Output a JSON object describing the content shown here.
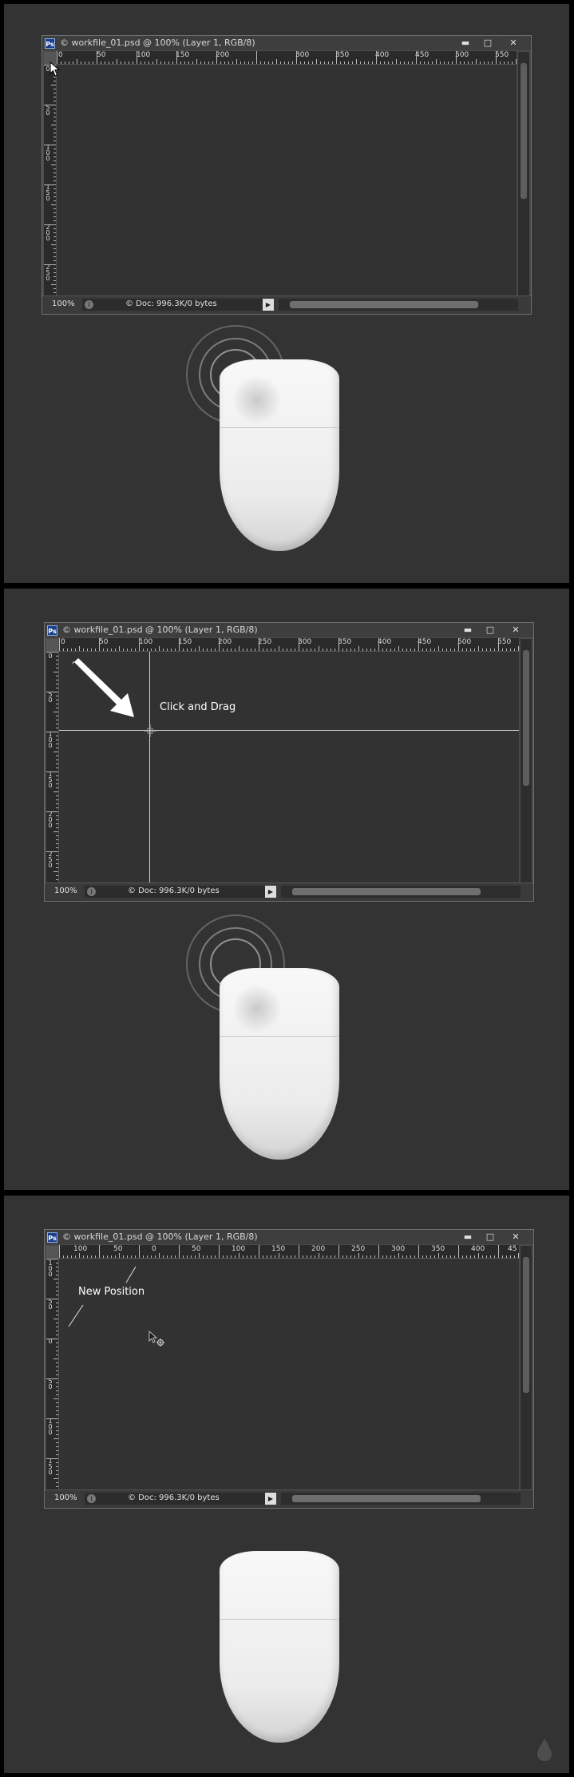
{
  "window": {
    "ps_badge": "Ps",
    "title": "© workfile_01.psd @ 100% (Layer 1, RGB/8)",
    "minimize_glyph": "▬",
    "maximize_glyph": "□",
    "close_glyph": "✕"
  },
  "status_bar": {
    "zoom": "100%",
    "doc_info": "© Doc: 996.3K/0 bytes",
    "doc_menu_glyph": "▶"
  },
  "steps": [
    {
      "h_ruler_labels": [
        "0",
        "50",
        "100",
        "150",
        "200",
        "300",
        "350",
        "400",
        "450",
        "500",
        "550"
      ],
      "v_ruler_labels": [
        "0",
        "50",
        "100",
        "150",
        "200",
        "250"
      ],
      "mouse_left_click_active": true
    },
    {
      "h_ruler_labels": [
        "0",
        "50",
        "100",
        "150",
        "200",
        "250",
        "300",
        "350",
        "400",
        "450",
        "500",
        "550"
      ],
      "v_ruler_labels": [
        "0",
        "50",
        "100",
        "150",
        "200",
        "250"
      ],
      "annotation": "Click and Drag",
      "mouse_left_click_active": true
    },
    {
      "h_ruler_labels": [
        "100",
        "50",
        "0",
        "50",
        "100",
        "150",
        "200",
        "250",
        "300",
        "350",
        "400",
        "45"
      ],
      "v_ruler_labels": [
        "100",
        "50",
        "0",
        "50",
        "100",
        "150"
      ],
      "annotation": "New Position",
      "mouse_left_click_active": false
    }
  ],
  "icons": [
    "photoshop-icon",
    "minimize-icon",
    "maximize-icon",
    "close-icon",
    "arrow-cursor-icon",
    "crosshair-cursor-icon",
    "pointer-drag-icon",
    "mouse-icon",
    "click-ripple-icon",
    "watermark-drop-icon"
  ],
  "colors": {
    "panel_bg": "#333333",
    "window_frame": "#4a4a4a",
    "canvas": "#323232",
    "ps_blue": "#1b3f8c"
  }
}
